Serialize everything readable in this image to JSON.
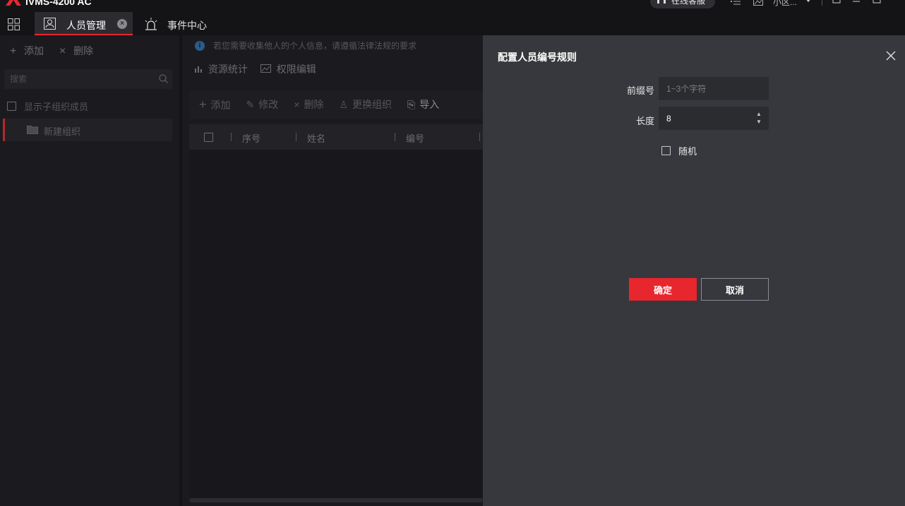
{
  "app": {
    "title": "iVMS-4200 AC"
  },
  "titlebar": {
    "support_label": "在线客服",
    "user_name": "小区...",
    "icons": [
      "headset-icon",
      "list-icon",
      "image-icon",
      "chevron-down-icon",
      "minimize-to-tray-icon",
      "minimize-icon",
      "maximize-icon"
    ]
  },
  "tabs": [
    {
      "label": "人员管理",
      "active": true,
      "icon": "person-card-icon"
    },
    {
      "label": "事件中心",
      "active": false,
      "icon": "alarm-light-icon"
    }
  ],
  "left_panel": {
    "add_label": "添加",
    "delete_label": "删除",
    "search_placeholder": "搜索",
    "show_sub_members_label": "显示子组织成员",
    "tree_items": [
      {
        "label": "新建组织"
      }
    ]
  },
  "main": {
    "notice": "若您需要收集他人的个人信息，请遵循法律法规的要求",
    "resource_stats_label": "资源统计",
    "permission_edit_label": "权限编辑",
    "toolbar": {
      "add_label": "添加",
      "modify_label": "修改",
      "delete_label": "删除",
      "change_org_label": "更换组织",
      "import_label": "导入"
    },
    "table": {
      "columns": [
        "序号",
        "姓名",
        "编号"
      ]
    }
  },
  "drawer": {
    "title": "配置人员编号规则",
    "prefix_label": "前缀号",
    "prefix_placeholder": "1~3个字符",
    "prefix_value": "",
    "length_label": "长度",
    "length_value": "8",
    "random_label": "随机",
    "random_checked": false,
    "ok_label": "确定",
    "cancel_label": "取消"
  },
  "colors": {
    "accent": "#e8262d",
    "background": "#141417",
    "panel": "#1b1b1f",
    "drawer": "#37383d"
  }
}
